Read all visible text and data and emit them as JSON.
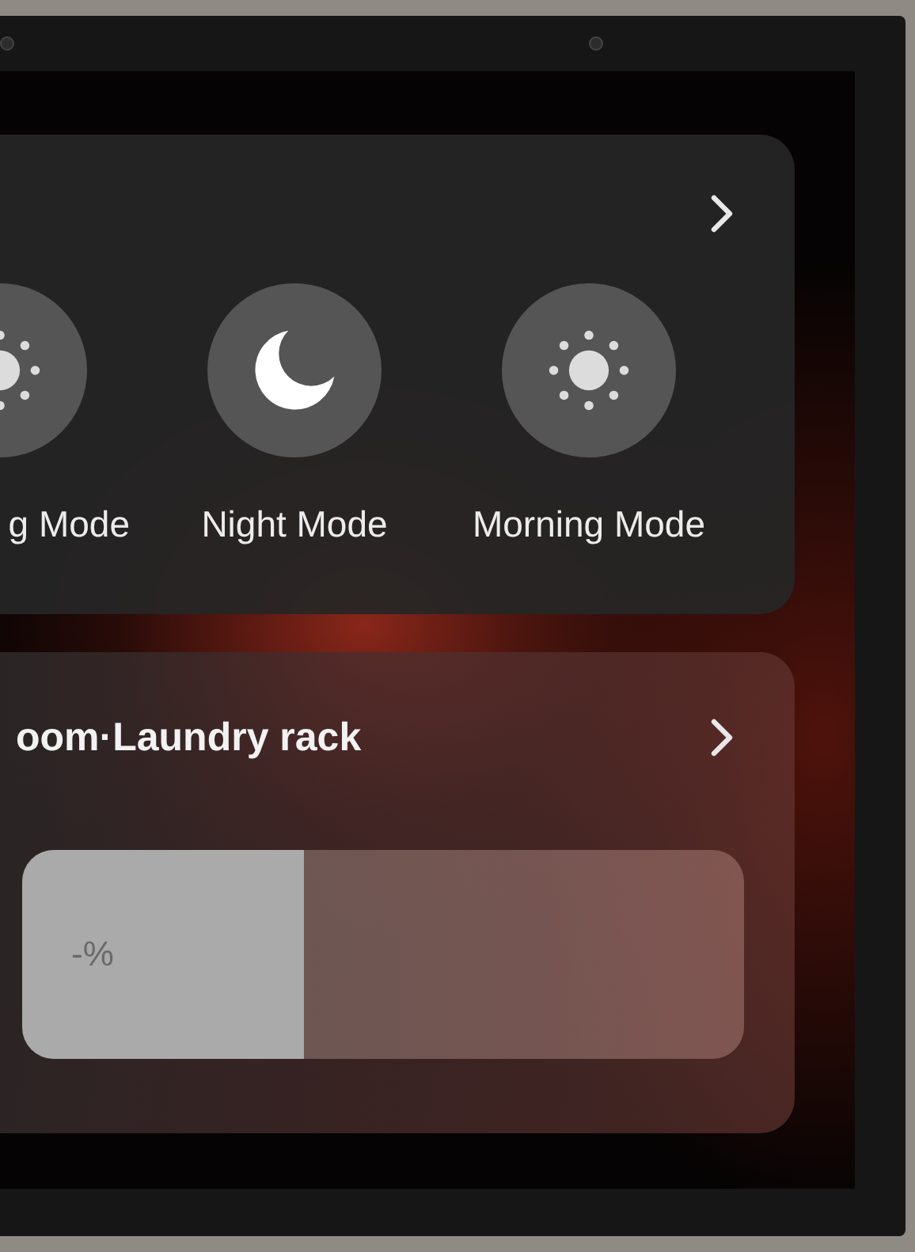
{
  "scene_card": {
    "modes": [
      {
        "label": "g Mode",
        "kind": "sun"
      },
      {
        "label": "Night Mode",
        "kind": "moon"
      },
      {
        "label": "Morning Mode",
        "kind": "sun"
      }
    ]
  },
  "device_card": {
    "title": "oom·Laundry rack",
    "slider": {
      "reading": "-%",
      "level": 0.39
    }
  }
}
